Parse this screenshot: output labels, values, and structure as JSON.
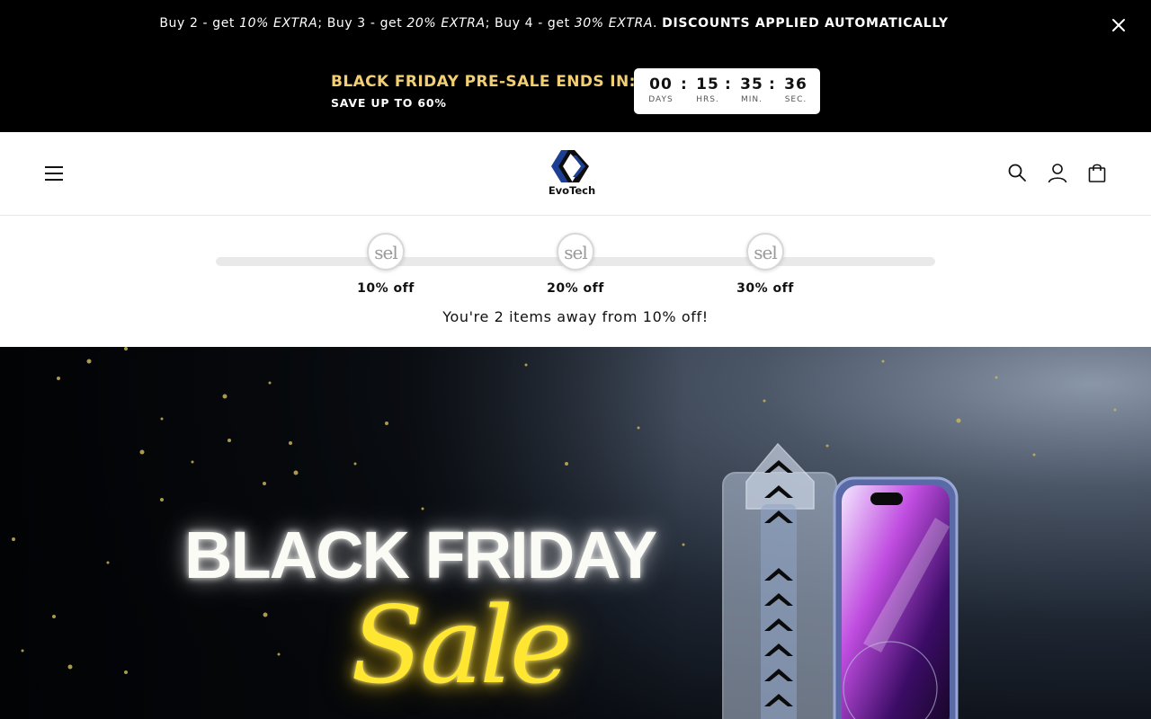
{
  "announcement": {
    "part1": "Buy 2 - get ",
    "pct1": "10% EXTRA",
    "part2": "; Buy 3 - get ",
    "pct2": "20% EXTRA",
    "part3": "; Buy 4 - get ",
    "pct3": "30% EXTRA",
    "part4": ". ",
    "bold": "DISCOUNTS APPLIED AUTOMATICALLY",
    "close_icon": "close-icon"
  },
  "countdown": {
    "heading": "BLACK FRIDAY PRE-SALE ENDS IN:",
    "subheading": "SAVE UP TO 60%",
    "units": [
      {
        "value": "00",
        "label": "DAYS"
      },
      {
        "value": "15",
        "label": "HRS."
      },
      {
        "value": "35",
        "label": "MIN."
      },
      {
        "value": "36",
        "label": "SEC."
      }
    ],
    "separator": ":"
  },
  "header": {
    "brand": "EvoTech",
    "icons": [
      "menu-icon",
      "search-icon",
      "account-icon",
      "cart-icon"
    ]
  },
  "tiers": {
    "progress_fraction": 0,
    "badge_text": "sel",
    "items": [
      {
        "label": "10% off"
      },
      {
        "label": "20% off"
      },
      {
        "label": "30% off"
      }
    ],
    "message": "You're 2 items away from 10% off!"
  },
  "hero": {
    "title": "BLACK FRIDAY",
    "script": "Sale"
  },
  "colors": {
    "accent_gold": "#f3cf74",
    "neon_yellow": "#ffe630",
    "bar_black": "#000000"
  }
}
